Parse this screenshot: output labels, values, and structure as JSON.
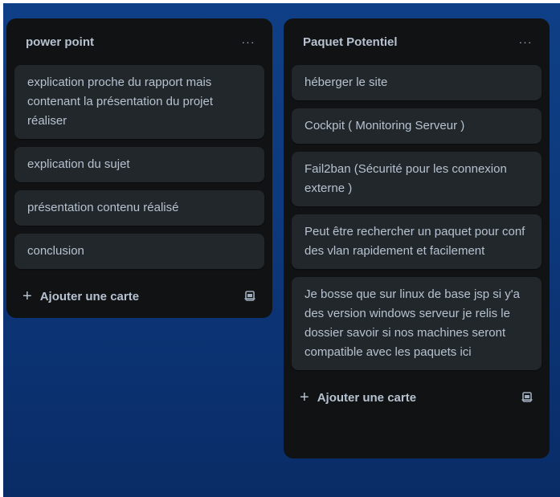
{
  "lists": [
    {
      "title": "power point",
      "menu_label": "···",
      "cards": [
        "explication proche du rapport mais contenant la présentation du projet réaliser",
        "explication du sujet",
        "présentation contenu réalisé",
        "conclusion"
      ],
      "add_label": "Ajouter une carte"
    },
    {
      "title": "Paquet Potentiel",
      "menu_label": "···",
      "cards": [
        "héberger le site",
        "Cockpit ( Monitoring Serveur )",
        "Fail2ban (Sécurité pour les connexion externe )",
        "Peut être rechercher un paquet pour conf des vlan rapidement et facilement",
        "Je bosse que sur linux de base jsp si y'a des version windows serveur je relis le dossier savoir si nos machines seront compatible avec les paquets ici"
      ],
      "add_label": "Ajouter une carte"
    }
  ],
  "icons": {
    "add": "plus-icon",
    "template": "card-template-icon",
    "menu": "more-icon"
  },
  "colors": {
    "board_background": "#0d3a7e",
    "list_background": "#111214",
    "card_background": "#22272b",
    "text": "#b6c2cf"
  }
}
